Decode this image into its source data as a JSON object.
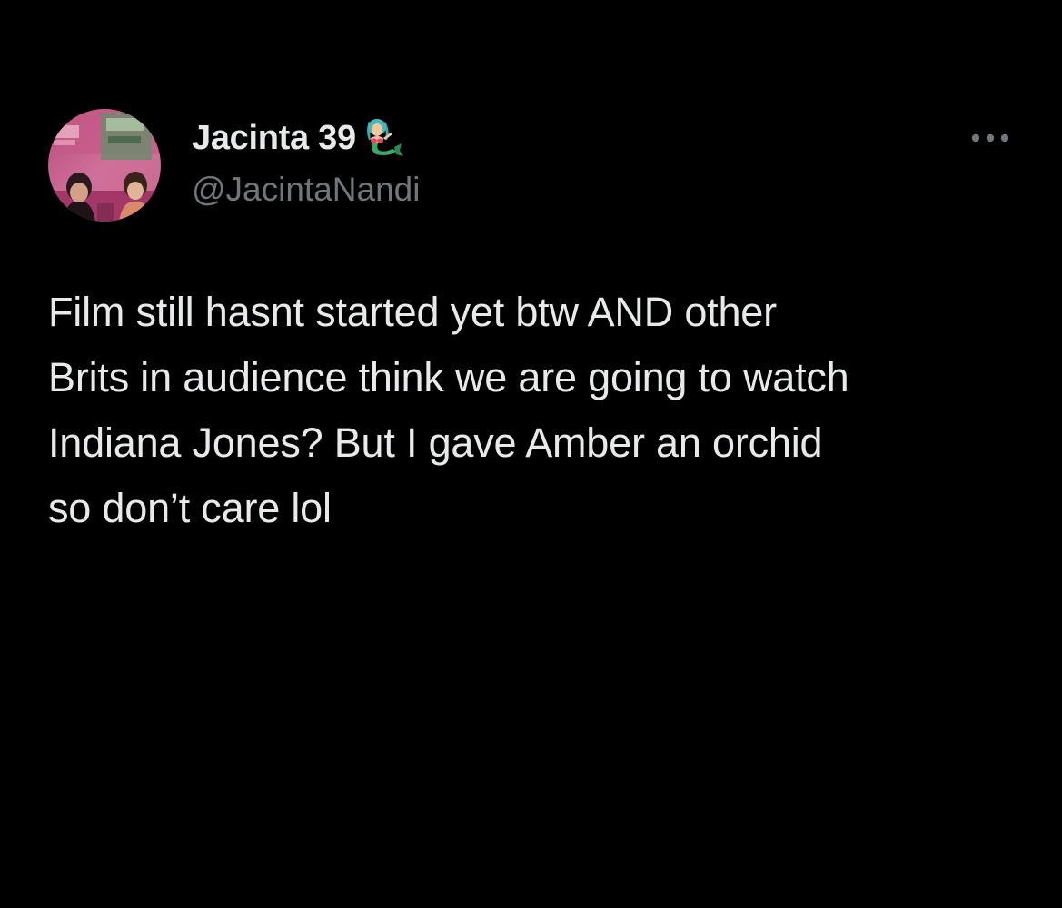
{
  "colors": {
    "background": "#000000",
    "primary_text": "#e7e9ea",
    "secondary_text": "#71767b"
  },
  "author": {
    "display_name": "Jacinta 39",
    "name_emoji": "mermaid-emoji",
    "handle": "@JacintaNandi",
    "avatar": "profile-photo-two-people-on-stage"
  },
  "actions": {
    "more_icon": "more-horizontal-icon"
  },
  "tweet": {
    "text": "Film still hasnt started yet btw AND other\nBrits in audience think we are going to watch\nIndiana Jones? But I gave Amber an orchid\nso don’t care lol"
  }
}
